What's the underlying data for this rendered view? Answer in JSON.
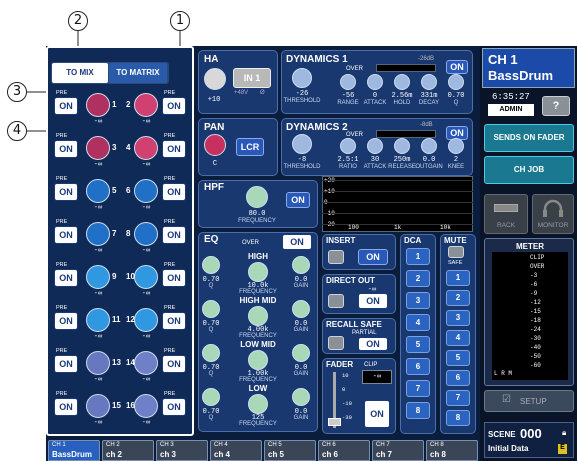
{
  "callouts": {
    "c1": "1",
    "c2": "2",
    "c3": "3",
    "c4": "4"
  },
  "tabs": {
    "to_mix": "TO MIX",
    "to_matrix": "TO MATRIX"
  },
  "send_rows": [
    {
      "pre": "PRE",
      "on": "ON",
      "left_num": "1",
      "right_num": "2",
      "left_val": "-∞",
      "right_val": "-∞",
      "left_color": "#b03060",
      "right_color": "#d04070"
    },
    {
      "pre": "PRE",
      "on": "ON",
      "left_num": "3",
      "right_num": "4",
      "left_val": "-∞",
      "right_val": "-∞",
      "left_color": "#b03060",
      "right_color": "#d04070"
    },
    {
      "pre": "PRE",
      "on": "ON",
      "left_num": "5",
      "right_num": "6",
      "left_val": "-∞",
      "right_val": "-∞",
      "left_color": "#2070c8",
      "right_color": "#2070c8"
    },
    {
      "pre": "PRE",
      "on": "ON",
      "left_num": "7",
      "right_num": "8",
      "left_val": "-∞",
      "right_val": "-∞",
      "left_color": "#2070c8",
      "right_color": "#2070c8"
    },
    {
      "pre": "PRE",
      "on": "ON",
      "left_num": "9",
      "right_num": "10",
      "left_val": "-∞",
      "right_val": "-∞",
      "left_color": "#3098e0",
      "right_color": "#3098e0"
    },
    {
      "pre": "PRE",
      "on": "ON",
      "left_num": "11",
      "right_num": "12",
      "left_val": "-∞",
      "right_val": "-∞",
      "left_color": "#3098e0",
      "right_color": "#3098e0"
    },
    {
      "pre": "PRE",
      "on": "ON",
      "left_num": "13",
      "right_num": "14",
      "left_val": "-∞",
      "right_val": "-∞",
      "left_color": "#6878c0",
      "right_color": "#7080c8"
    },
    {
      "pre": "PRE",
      "on": "ON",
      "left_num": "15",
      "right_num": "16",
      "left_val": "-∞",
      "right_val": "-∞",
      "left_color": "#6878c0",
      "right_color": "#7080c8"
    }
  ],
  "ha": {
    "title": "HA",
    "in_label": "IN 1",
    "phantom": "+48V",
    "phase": "Ø",
    "value": "+10"
  },
  "pan": {
    "title": "PAN",
    "lcr": "LCR",
    "value": "C"
  },
  "dyn1": {
    "title": "DYNAMICS 1",
    "over": "OVER",
    "on": "ON",
    "meter": "-26dB",
    "thr_val": "-26",
    "thr_lbl": "THRESHOLD",
    "params": [
      {
        "v": "-56",
        "l": "RANGE"
      },
      {
        "v": "0",
        "l": "ATTACK"
      },
      {
        "v": "2.56m",
        "l": "HOLD"
      },
      {
        "v": "331m",
        "l": "DECAY"
      },
      {
        "v": "0.70",
        "l": "Q"
      }
    ]
  },
  "dyn2": {
    "title": "DYNAMICS 2",
    "over": "OVER",
    "on": "ON",
    "meter": "-8dB",
    "thr_val": "-8",
    "thr_lbl": "THRESHOLD",
    "params": [
      {
        "v": "2.5:1",
        "l": "RATIO"
      },
      {
        "v": "30",
        "l": "ATTACK"
      },
      {
        "v": "250m",
        "l": "RELEASE"
      },
      {
        "v": "0.0",
        "l": "OUTGAIN"
      },
      {
        "v": "2",
        "l": "KNEE"
      }
    ]
  },
  "hpf": {
    "title": "HPF",
    "on": "ON",
    "value": "80.0",
    "lbl": "FREQUENCY"
  },
  "graph": {
    "y": [
      "+20",
      "+10",
      "0",
      "-10",
      "-20"
    ],
    "x": [
      "100",
      "1k",
      "10k"
    ]
  },
  "eq": {
    "title": "EQ",
    "over": "OVER",
    "on": "ON",
    "bands": [
      {
        "name": "HIGH",
        "q": "0.70",
        "ql": "Q",
        "freq": "10.0k",
        "fl": "FREQUENCY",
        "gain": "0.0",
        "gl": "GAIN"
      },
      {
        "name": "HIGH MID",
        "q": "0.70",
        "ql": "Q",
        "freq": "4.00k",
        "fl": "FREQUENCY",
        "gain": "0.0",
        "gl": "GAIN"
      },
      {
        "name": "LOW MID",
        "q": "0.70",
        "ql": "Q",
        "freq": "1.00k",
        "fl": "FREQUENCY",
        "gain": "0.0",
        "gl": "GAIN"
      },
      {
        "name": "LOW",
        "q": "0.70",
        "ql": "Q",
        "freq": "125",
        "fl": "FREQUENCY",
        "gain": "0.0",
        "gl": "GAIN"
      }
    ]
  },
  "insert": {
    "title": "INSERT",
    "on": "ON"
  },
  "direct": {
    "title": "DIRECT OUT",
    "on": "ON",
    "val": "-∞"
  },
  "recall": {
    "title": "RECALL SAFE",
    "partial": "PARTIAL",
    "on": "ON"
  },
  "fader": {
    "title": "FADER",
    "clip": "CLIP",
    "val": "-∞",
    "on": "ON",
    "scale": [
      "10",
      "0",
      "-10",
      "-30"
    ]
  },
  "dca": {
    "title": "DCA",
    "items": [
      "1",
      "2",
      "3",
      "4",
      "5",
      "6",
      "7",
      "8"
    ]
  },
  "mute": {
    "title": "MUTE",
    "safe": "SAFE",
    "items": [
      "1",
      "2",
      "3",
      "4",
      "5",
      "6",
      "7",
      "8"
    ]
  },
  "right": {
    "ch_num": "CH 1",
    "ch_name": "BassDrum",
    "time": "6:35:27",
    "user": "ADMIN",
    "help": "?",
    "sends": "SENDS ON FADER",
    "chjob": "CH JOB",
    "rack": "RACK",
    "monitor": "MONITOR",
    "meter_title": "METER",
    "meter_scale": [
      "CLIP",
      "OVER",
      "-3",
      "-6",
      "-9",
      "-12",
      "-15",
      "-18",
      "-24",
      "-30",
      "-40",
      "-50",
      "-60"
    ],
    "lrm": "L R M",
    "setup": "SETUP",
    "scene_lbl": "SCENE",
    "scene_num": "000",
    "scene_name": "Initial Data",
    "e": "E"
  },
  "bottom_tabs": [
    {
      "num": "CH 1",
      "name": "BassDrum"
    },
    {
      "num": "CH 2",
      "name": "ch 2"
    },
    {
      "num": "CH 3",
      "name": "ch 3"
    },
    {
      "num": "CH 4",
      "name": "ch 4"
    },
    {
      "num": "CH 5",
      "name": "ch 5"
    },
    {
      "num": "CH 6",
      "name": "ch 6"
    },
    {
      "num": "CH 7",
      "name": "ch 7"
    },
    {
      "num": "CH 8",
      "name": "ch 8"
    }
  ]
}
